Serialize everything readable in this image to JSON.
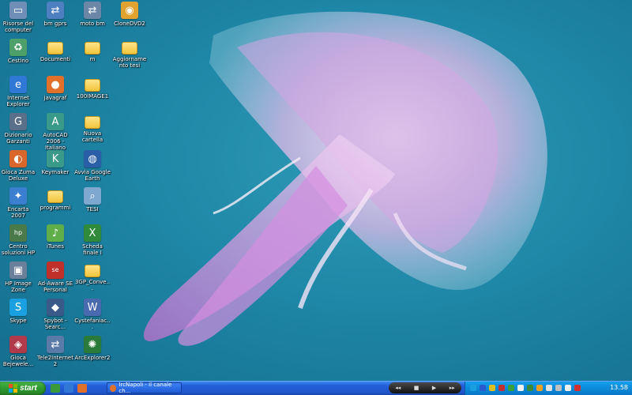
{
  "desktop": {
    "icons": [
      {
        "label": "Risorse del computer",
        "icon": "my-computer-icon",
        "color": "#6f8fb8"
      },
      {
        "label": "bm gprs",
        "icon": "network-shortcut-icon",
        "color": "#4d7fc1"
      },
      {
        "label": "moto bm",
        "icon": "network-shortcut-icon",
        "color": "#6c86a8"
      },
      {
        "label": "CloneDVD2",
        "icon": "clonedvd-icon",
        "color": "#e2a230"
      },
      {
        "label": "Cestino",
        "icon": "recycle-bin-icon",
        "color": "#4ea06a"
      },
      {
        "label": "Documenti",
        "icon": "folder-icon",
        "color": "#f2c43d"
      },
      {
        "label": "m",
        "icon": "folder-icon",
        "color": "#f2c43d"
      },
      {
        "label": "Aggiornamento tesi",
        "icon": "folder-icon",
        "color": "#f2c43d"
      },
      {
        "label": "Internet Explorer",
        "icon": "internet-explorer-icon",
        "color": "#2f78d6"
      },
      {
        "label": "javagraf",
        "icon": "firefox-icon",
        "color": "#e0702a"
      },
      {
        "label": "100IMAGE1",
        "icon": "folder-icon",
        "color": "#f2c43d"
      },
      {
        "label": "Dizionario Garzanti",
        "icon": "dictionary-icon",
        "color": "#5a6f8a"
      },
      {
        "label": "AutoCAD 2006 - Italiano",
        "icon": "autocad-icon",
        "color": "#3a9a8a"
      },
      {
        "label": "Nuova cartella",
        "icon": "folder-icon",
        "color": "#f2c43d"
      },
      {
        "label": "Gioca Zuma Deluxe",
        "icon": "zuma-game-icon",
        "color": "#d9662a"
      },
      {
        "label": "Keymaker",
        "icon": "keymaker-icon",
        "color": "#3a9a8a"
      },
      {
        "label": "Avvia Google Earth",
        "icon": "google-earth-icon",
        "color": "#2a5fa8"
      },
      {
        "label": "Encarta 2007",
        "icon": "encarta-icon",
        "color": "#3a7fd0"
      },
      {
        "label": "programmi",
        "icon": "folder-icon",
        "color": "#f2c43d"
      },
      {
        "label": "TESI",
        "icon": "search-icon",
        "color": "#7fa8d0"
      },
      {
        "label": "Centro soluzioni HP",
        "icon": "hp-solution-center-icon",
        "color": "#4a7a4a"
      },
      {
        "label": "iTunes",
        "icon": "itunes-icon",
        "color": "#5fae4a"
      },
      {
        "label": "Scheda finale I",
        "icon": "excel-document-icon",
        "color": "#2f8a3a"
      },
      {
        "label": "HP Image Zone",
        "icon": "hp-image-zone-icon",
        "color": "#6a7f9a"
      },
      {
        "label": "Ad-Aware SE Personal",
        "icon": "ad-aware-icon",
        "color": "#c0302a"
      },
      {
        "label": "3GP_Conve...",
        "icon": "folder-icon",
        "color": "#f2c43d"
      },
      {
        "label": "Skype",
        "icon": "skype-icon",
        "color": "#1aa0e0"
      },
      {
        "label": "Spybot - Searc...",
        "icon": "spybot-icon",
        "color": "#3a5a8a"
      },
      {
        "label": "Cystefaniac...",
        "icon": "word-document-icon",
        "color": "#4a6ab0"
      },
      {
        "label": "Gioca Bejewele...",
        "icon": "bejeweled-game-icon",
        "color": "#b03a4a"
      },
      {
        "label": "Tele2Internet 2",
        "icon": "network-shortcut-icon",
        "color": "#5a7aa8"
      },
      {
        "label": "ArcExplorer2",
        "icon": "arcexplorer-icon",
        "color": "#2a7a3a"
      }
    ]
  },
  "taskbar": {
    "start_label": "start",
    "quick_launch": [
      {
        "icon": "show-desktop-icon",
        "color": "#3a9a3a"
      },
      {
        "icon": "internet-explorer-icon",
        "color": "#2f78d6"
      },
      {
        "icon": "firefox-icon",
        "color": "#e0702a"
      }
    ],
    "task_button": {
      "label": "IrcNapoli - il canale ch...",
      "icon": "firefox-icon"
    },
    "media_controls": [
      "◂◂",
      "■",
      "▶",
      "▸▸"
    ],
    "tray_icons": [
      {
        "icon": "skype-tray-icon",
        "color": "#1aa0e0"
      },
      {
        "icon": "bluetooth-tray-icon",
        "color": "#2a5ad0"
      },
      {
        "icon": "security-tray-icon",
        "color": "#e0c020"
      },
      {
        "icon": "antivirus-tray-icon",
        "color": "#c03030"
      },
      {
        "icon": "shield-tray-icon",
        "color": "#3aa03a"
      },
      {
        "icon": "network-tray-icon",
        "color": "#f0f0f0"
      },
      {
        "icon": "messenger-tray-icon",
        "color": "#3a8a3a"
      },
      {
        "icon": "update-tray-icon",
        "color": "#f0a020"
      },
      {
        "icon": "volume-tray-icon",
        "color": "#e0e0e0"
      },
      {
        "icon": "printer-tray-icon",
        "color": "#c0c0c0"
      },
      {
        "icon": "wifi-tray-icon",
        "color": "#f0f0f0"
      },
      {
        "icon": "ati-tray-icon",
        "color": "#d03030"
      }
    ],
    "clock": "13.58"
  }
}
